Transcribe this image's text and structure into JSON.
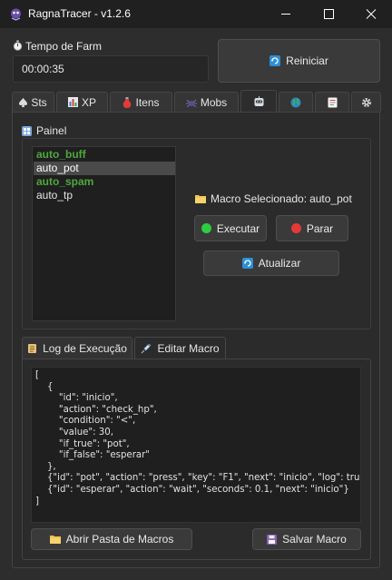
{
  "window": {
    "title": "RagnaTracer - v1.2.6",
    "icon": "app-logo-icon",
    "controls": {
      "minimize": "—",
      "maximize": "☐",
      "close": "✕"
    }
  },
  "farm": {
    "label": "Tempo de Farm",
    "label_icon": "stopwatch-icon",
    "time": "00:00:35",
    "restart_label": "Reiniciar",
    "restart_icon": "refresh-icon"
  },
  "tabs": [
    {
      "label": "Sts",
      "icon": "spade-icon"
    },
    {
      "label": "XP",
      "icon": "bar-chart-icon"
    },
    {
      "label": "Itens",
      "icon": "potion-icon"
    },
    {
      "label": "Mobs",
      "icon": "spider-icon"
    },
    {
      "label": "",
      "icon": "robot-icon",
      "active": true
    },
    {
      "label": "",
      "icon": "globe-icon"
    },
    {
      "label": "",
      "icon": "notes-icon"
    },
    {
      "label": "",
      "icon": "gear-icon"
    }
  ],
  "panel": {
    "label": "Painel",
    "label_icon": "panel-icon",
    "macros": [
      {
        "name": "auto_buff",
        "style": "green"
      },
      {
        "name": "auto_pot",
        "style": "selected"
      },
      {
        "name": "auto_spam",
        "style": "green"
      },
      {
        "name": "auto_tp",
        "style": "normal"
      }
    ],
    "selected_prefix": "Macro Selecionado:",
    "selected_value": "auto_pot",
    "selected_icon": "folder-icon",
    "execute_label": "Executar",
    "stop_label": "Parar",
    "refresh_label": "Atualizar",
    "colors": {
      "execute_dot": "#2ecc40",
      "stop_dot": "#e53935",
      "green_text": "#4fa83d"
    }
  },
  "subtabs": [
    {
      "label": "Log de Execução",
      "icon": "scroll-icon"
    },
    {
      "label": "Editar Macro",
      "icon": "syringe-icon",
      "active": true
    }
  ],
  "editor": {
    "content": "[\n    {\n        \"id\": \"inicio\",\n        \"action\": \"check_hp\",\n        \"condition\": \"<\",\n        \"value\": 30,\n        \"if_true\": \"pot\",\n        \"if_false\": \"esperar\"\n    },\n    {\"id\": \"pot\", \"action\": \"press\", \"key\": \"F1\", \"next\": \"inicio\", \"log\": true},\n    {\"id\": \"esperar\", \"action\": \"wait\", \"seconds\": 0.1, \"next\": \"inicio\"}\n]"
  },
  "footer": {
    "open_folder_label": "Abrir Pasta de Macros",
    "save_label": "Salvar Macro"
  }
}
